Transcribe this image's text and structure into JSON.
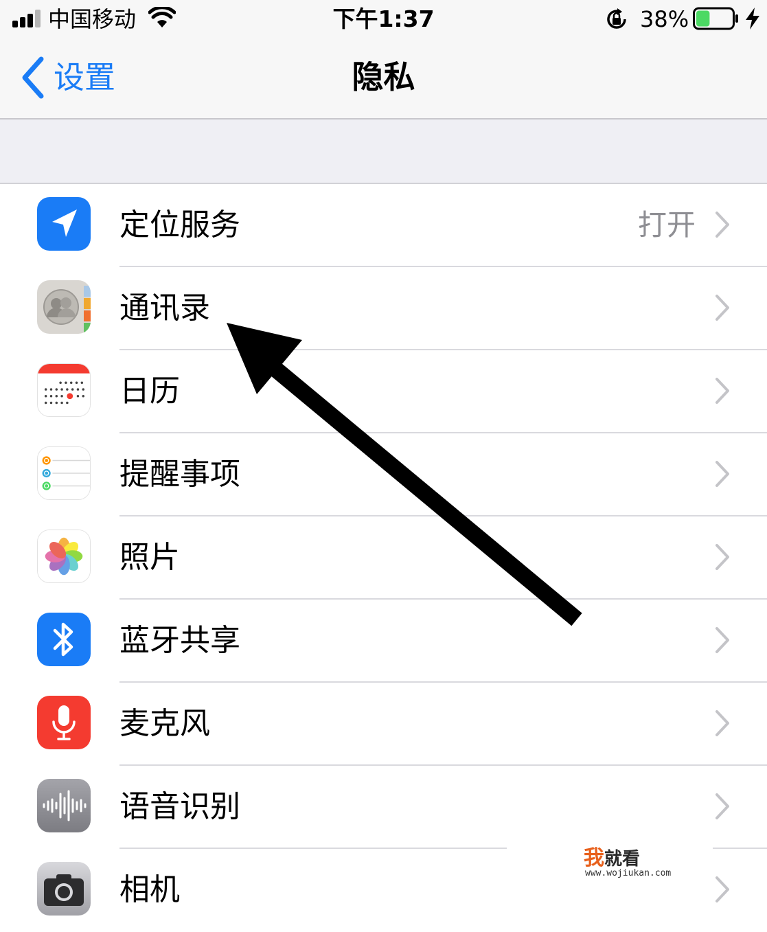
{
  "status_bar": {
    "carrier": "中国移动",
    "time": "下午1:37",
    "battery_percent": "38%",
    "battery_level": 0.38,
    "charging": true,
    "icons": [
      "signal-icon",
      "wifi-icon",
      "orientation-lock-icon",
      "battery-icon",
      "charging-bolt-icon"
    ]
  },
  "nav": {
    "back_label": "设置",
    "title": "隐私"
  },
  "colors": {
    "accent": "#1a7cf6",
    "secondary_text": "#8e8e93",
    "group_background": "#efeff4",
    "annotation_arrow": "#000000"
  },
  "rows": [
    {
      "label": "定位服务",
      "value": "打开",
      "icon": "location-services-icon",
      "icon_color": "#1a7cf6"
    },
    {
      "label": "通讯录",
      "value": "",
      "icon": "contacts-icon",
      "icon_color": "#d6d4d0"
    },
    {
      "label": "日历",
      "value": "",
      "icon": "calendar-icon",
      "icon_color": "#ffffff"
    },
    {
      "label": "提醒事项",
      "value": "",
      "icon": "reminders-icon",
      "icon_color": "#ffffff"
    },
    {
      "label": "照片",
      "value": "",
      "icon": "photos-icon",
      "icon_color": "#ffffff"
    },
    {
      "label": "蓝牙共享",
      "value": "",
      "icon": "bluetooth-icon",
      "icon_color": "#1a7cf6"
    },
    {
      "label": "麦克风",
      "value": "",
      "icon": "microphone-icon",
      "icon_color": "#f43b30"
    },
    {
      "label": "语音识别",
      "value": "",
      "icon": "speech-recognition-icon",
      "icon_color": "#8e8e93"
    },
    {
      "label": "相机",
      "value": "",
      "icon": "camera-icon",
      "icon_color": "#8e8e93"
    }
  ],
  "annotation": {
    "type": "arrow",
    "points_to": "通讯录"
  },
  "watermark": {
    "first_char": "我",
    "rest": "就看",
    "url": "www.wojiukan.com"
  }
}
